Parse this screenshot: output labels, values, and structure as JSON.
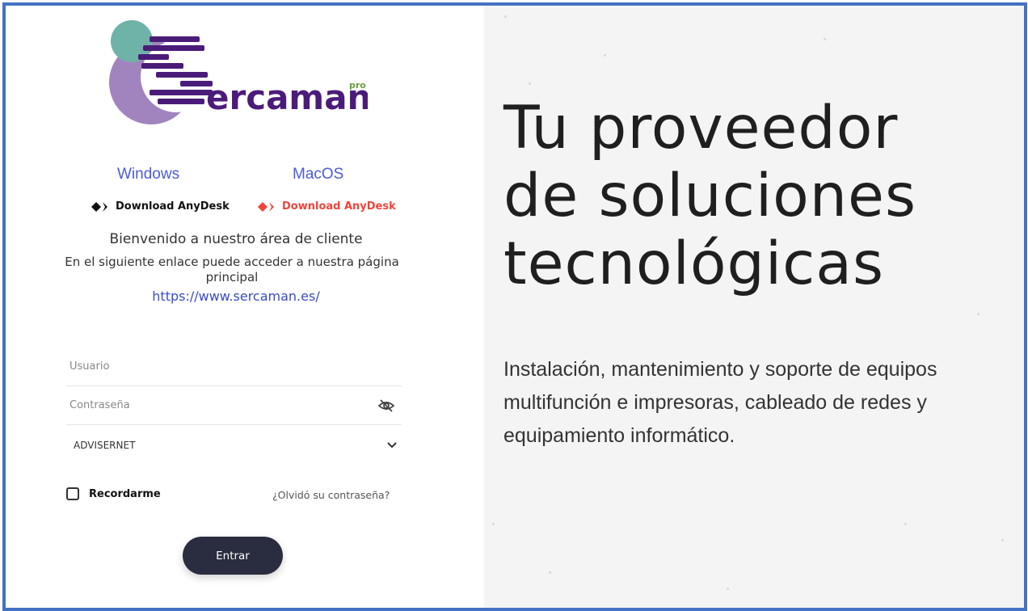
{
  "brand": {
    "logo_text": "ercaman",
    "logo_superscript": "pro",
    "colors": {
      "teal": "#6fb3a8",
      "purple": "#4b1b7a",
      "lavender": "#9a78b5"
    }
  },
  "downloads": {
    "windows": {
      "label": "Windows",
      "link_text": "Download AnyDesk",
      "icon": "anydesk-icon",
      "color": "#111111"
    },
    "macos": {
      "label": "MacOS",
      "link_text": "Download AnyDesk",
      "icon": "anydesk-icon",
      "color": "#ef443b"
    }
  },
  "welcome": {
    "title": "Bienvenido a nuestro área de cliente",
    "subtitle": "En el siguiente enlace puede acceder a nuestra página principal",
    "url": "https://www.sercaman.es/"
  },
  "login": {
    "username_placeholder": "Usuario",
    "password_placeholder": "Contraseña",
    "password_toggle_icon": "eye-slash-icon",
    "company_selected": "ADVISERNET",
    "company_dropdown_icon": "chevron-down-icon",
    "remember_label": "Recordarme",
    "remember_checked": false,
    "forgot_label": "¿Olvidó su contraseña?",
    "submit_label": "Entrar"
  },
  "hero": {
    "line1": "Tu proveedor",
    "line2": "de soluciones",
    "line3": "tecnológicas",
    "description": "Instalación, mantenimiento y soporte de equipos multifunción e impresoras, cableado de redes y equipamiento informático."
  }
}
